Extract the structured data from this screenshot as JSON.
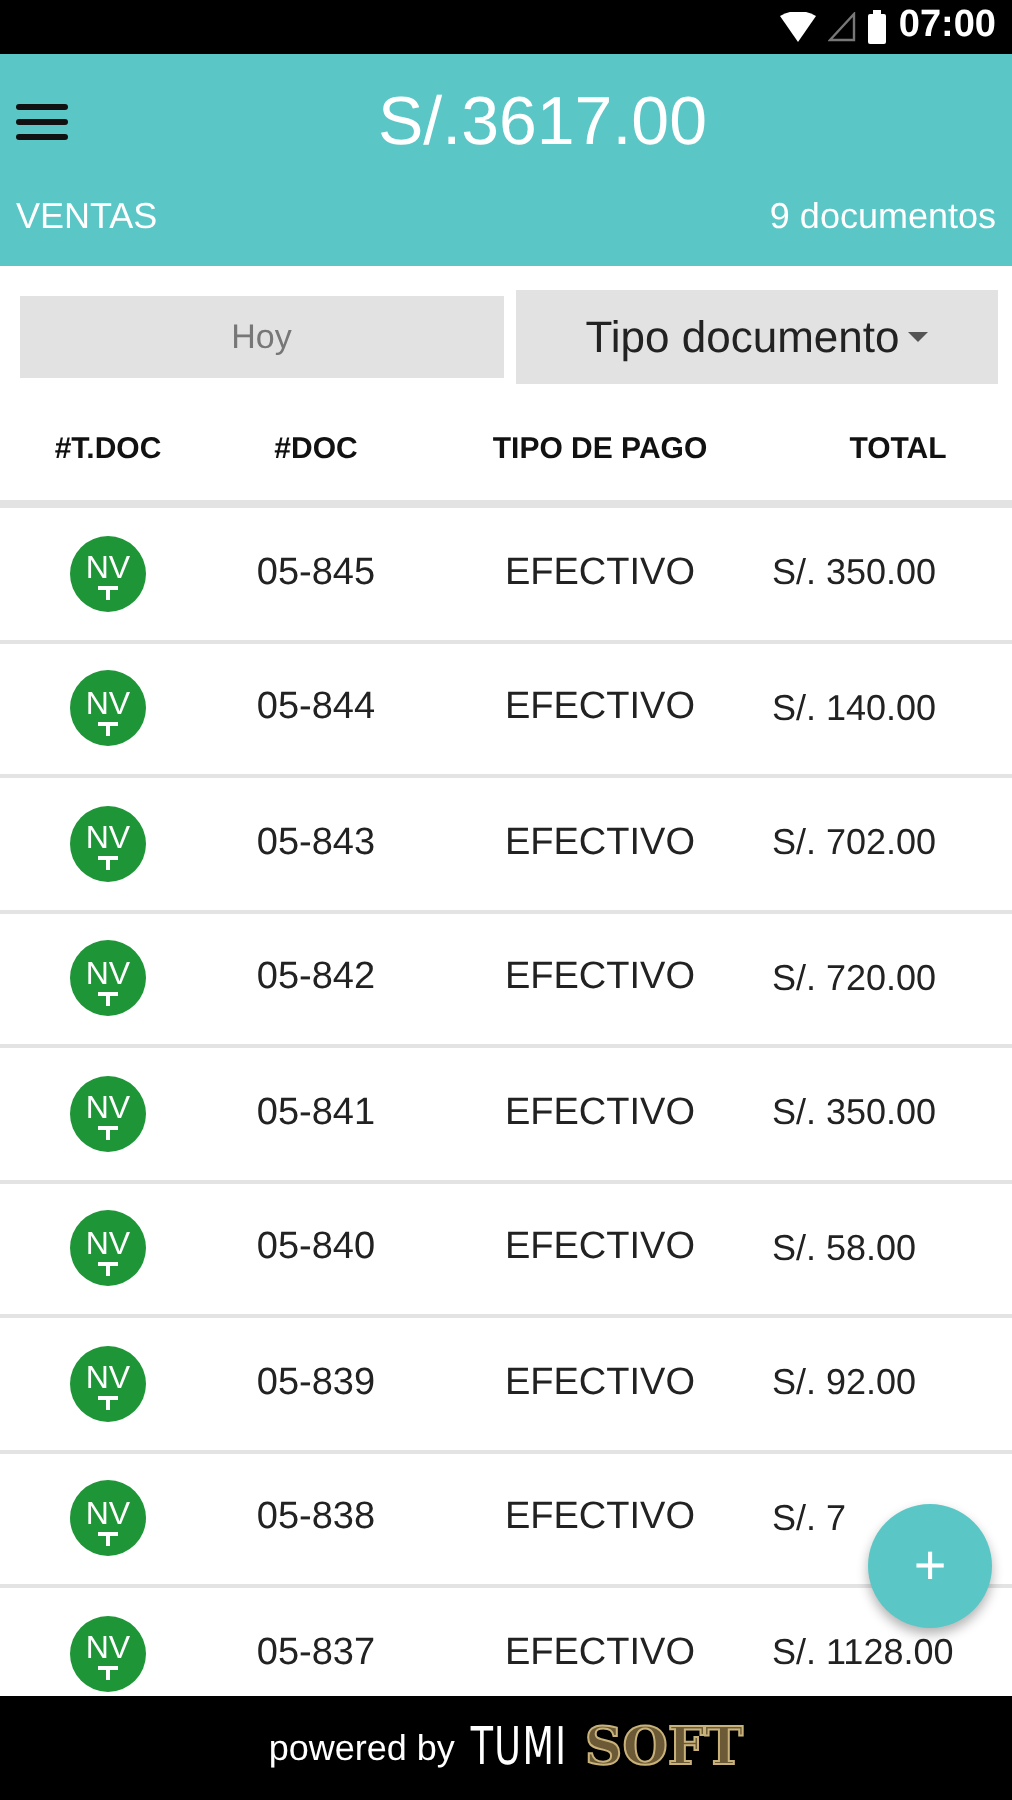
{
  "status_bar": {
    "time": "07:00"
  },
  "header": {
    "total": "S/.3617.00",
    "section": "VENTAS",
    "count": "9 documentos"
  },
  "filters": {
    "date": "Hoy",
    "type_dropdown": "Tipo documento"
  },
  "table": {
    "columns": [
      "#T.DOC",
      "#DOC",
      "TIPO DE PAGO",
      "TOTAL"
    ],
    "rows": [
      {
        "type": "NV",
        "color": "#1e9637",
        "doc": "05-845",
        "payment": "EFECTIVO",
        "total": "S/. 350.00"
      },
      {
        "type": "NV",
        "color": "#1e9637",
        "doc": "05-844",
        "payment": "EFECTIVO",
        "total": "S/. 140.00"
      },
      {
        "type": "NV",
        "color": "#1e9637",
        "doc": "05-843",
        "payment": "EFECTIVO",
        "total": "S/. 702.00"
      },
      {
        "type": "NV",
        "color": "#1e9637",
        "doc": "05-842",
        "payment": "EFECTIVO",
        "total": "S/. 720.00"
      },
      {
        "type": "NV",
        "color": "#1e9637",
        "doc": "05-841",
        "payment": "EFECTIVO",
        "total": "S/. 350.00"
      },
      {
        "type": "NV",
        "color": "#1e9637",
        "doc": "05-840",
        "payment": "EFECTIVO",
        "total": "S/. 58.00"
      },
      {
        "type": "NV",
        "color": "#1e9637",
        "doc": "05-839",
        "payment": "EFECTIVO",
        "total": "S/. 92.00"
      },
      {
        "type": "NV",
        "color": "#1e9637",
        "doc": "05-838",
        "payment": "EFECTIVO",
        "total": "S/. 7"
      },
      {
        "type": "NV",
        "color": "#1e9637",
        "doc": "05-837",
        "payment": "EFECTIVO",
        "total": "S/. 1128.00"
      }
    ]
  },
  "fab": {
    "label": "+"
  },
  "footer": {
    "prefix": "powered by",
    "brand_first": "TUMI",
    "brand_second": "SOFT"
  }
}
